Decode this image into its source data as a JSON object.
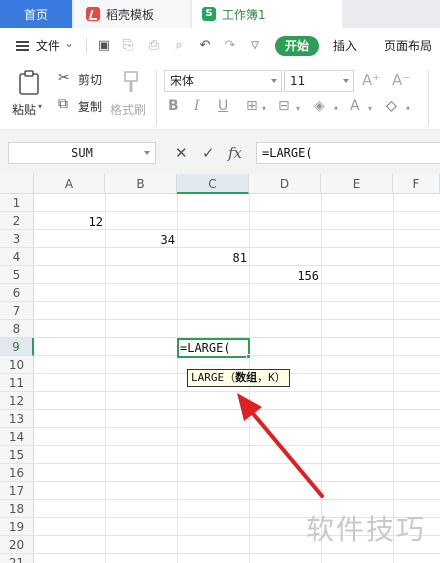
{
  "tabs": {
    "home": "首页",
    "template": "稻壳模板",
    "workbook": "工作簿1",
    "workbook_icon_letter": "S"
  },
  "menu": {
    "file": "文件",
    "start": "开始",
    "insert": "插入",
    "page_layout": "页面布局"
  },
  "ribbon": {
    "paste": "粘贴",
    "cut": "剪切",
    "copy": "复制",
    "format_painter": "格式刷",
    "font_name": "宋体",
    "font_size": "11"
  },
  "formula_bar": {
    "name_box": "SUM",
    "fx_label": "fx",
    "formula": "=LARGE("
  },
  "grid": {
    "columns": [
      "A",
      "B",
      "C",
      "D",
      "E",
      "F"
    ],
    "selected_column": "C",
    "rows": [
      "1",
      "2",
      "3",
      "4",
      "5",
      "6",
      "7",
      "8",
      "9",
      "10",
      "11",
      "12",
      "13",
      "14",
      "15",
      "16",
      "17",
      "18",
      "19",
      "20",
      "21"
    ],
    "selected_row": "9",
    "cells": {
      "A2": "12",
      "B3": "34",
      "C4": "81",
      "D5": "156",
      "C9": "=LARGE("
    },
    "tooltip": {
      "func": "LARGE",
      "open": "（",
      "arg1": "数组",
      "sep": "，",
      "arg2": "K",
      "close": "）"
    }
  },
  "watermark": "软件技巧",
  "colors": {
    "accent_green": "#2e9d56",
    "tab_blue": "#3b7bdf",
    "arrow_red": "#e02020"
  }
}
